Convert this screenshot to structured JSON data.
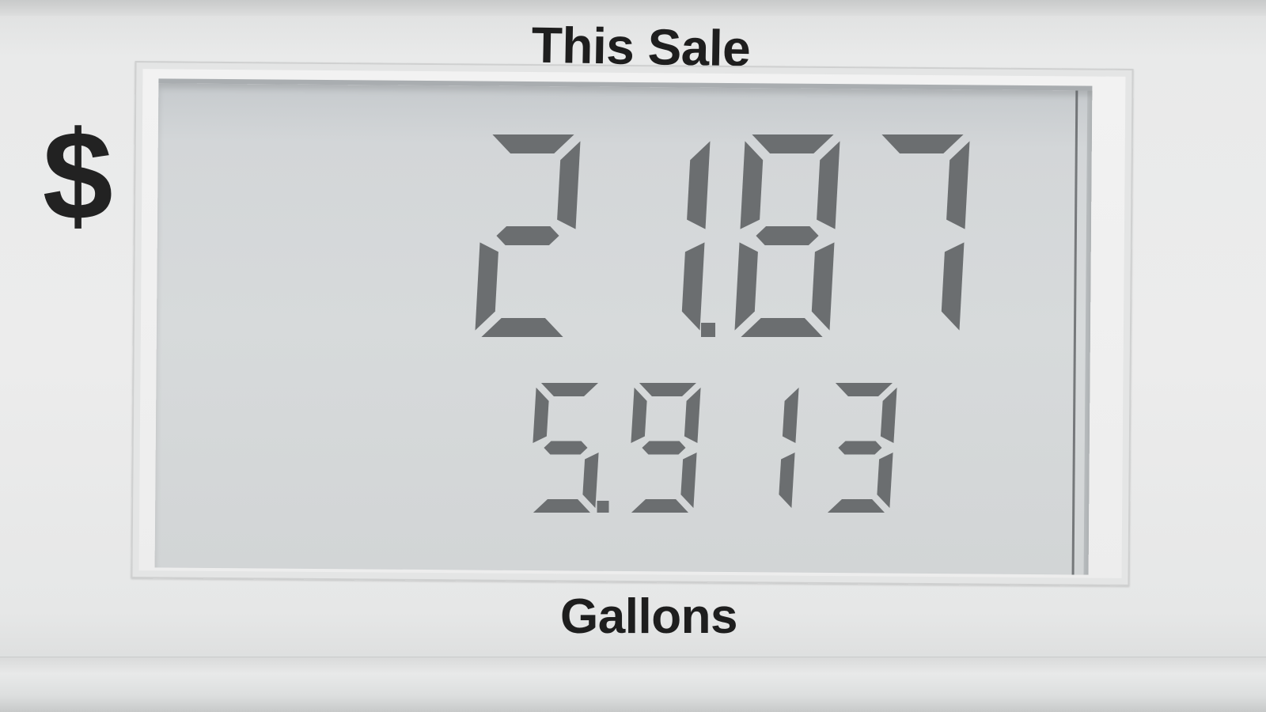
{
  "pump": {
    "title": "This Sale",
    "currency_symbol": "$",
    "units": "Gallons",
    "sale_amount": "21.87",
    "volume": "5.913"
  },
  "colors": {
    "lcd_background": "#d3d6d8",
    "segment_on": "#6b6e70",
    "label_text": "#1e1e1e",
    "bezel": "#ededed"
  }
}
